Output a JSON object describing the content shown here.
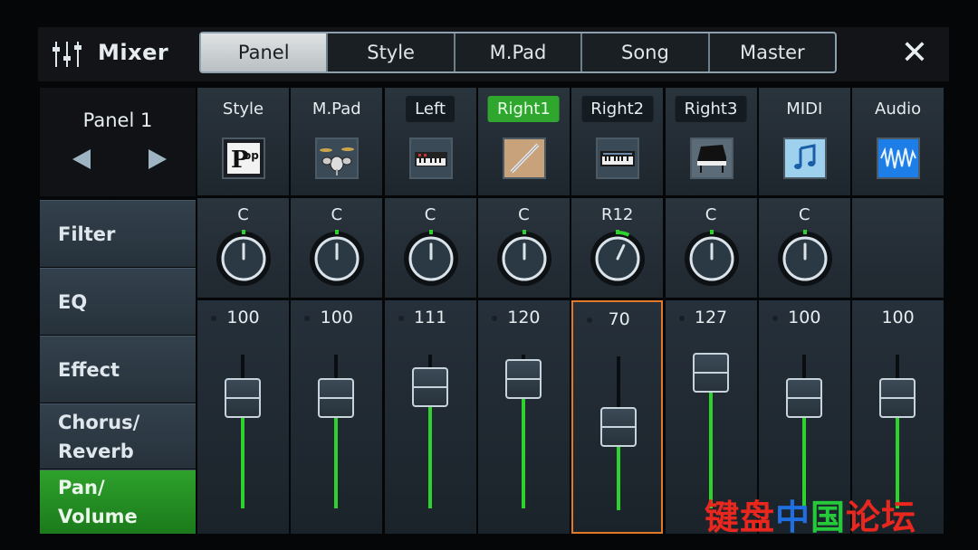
{
  "window": {
    "title": "Mixer",
    "close_label": "✕"
  },
  "tabs": [
    {
      "label": "Panel",
      "active": true
    },
    {
      "label": "Style",
      "active": false
    },
    {
      "label": "M.Pad",
      "active": false
    },
    {
      "label": "Song",
      "active": false
    },
    {
      "label": "Master",
      "active": false
    }
  ],
  "panel_selector": {
    "name": "Panel 1"
  },
  "side_menu": [
    {
      "label": "Filter",
      "active": false
    },
    {
      "label": "EQ",
      "active": false
    },
    {
      "label": "Effect",
      "active": false
    },
    {
      "label": "Chorus/\nReverb",
      "active": false
    },
    {
      "label": "Pan/\nVolume",
      "active": true
    }
  ],
  "channels": [
    {
      "label": "Style",
      "label_style": "plain",
      "icon": "pop-style-icon",
      "pan": "C",
      "pan_value": 0,
      "volume": "100",
      "volume_value": 100,
      "has_pan": true
    },
    {
      "label": "M.Pad",
      "label_style": "plain",
      "icon": "drum-kit-icon",
      "pan": "C",
      "pan_value": 0,
      "volume": "100",
      "volume_value": 100,
      "has_pan": true
    },
    {
      "label": "Left",
      "label_style": "boxed",
      "icon": "synth-keyboard-icon",
      "pan": "C",
      "pan_value": 0,
      "volume": "111",
      "volume_value": 111,
      "has_pan": true
    },
    {
      "label": "Right1",
      "label_style": "active",
      "icon": "flute-icon",
      "pan": "C",
      "pan_value": 0,
      "volume": "120",
      "volume_value": 120,
      "has_pan": true
    },
    {
      "label": "Right2",
      "label_style": "boxed",
      "icon": "keyboard-icon",
      "pan": "R12",
      "pan_value": 12,
      "volume": "70",
      "volume_value": 70,
      "has_pan": true,
      "selected": true
    },
    {
      "label": "Right3",
      "label_style": "boxed",
      "icon": "grand-piano-icon",
      "pan": "C",
      "pan_value": 0,
      "volume": "127",
      "volume_value": 127,
      "has_pan": true
    },
    {
      "label": "MIDI",
      "label_style": "plain",
      "icon": "music-note-icon",
      "pan": "C",
      "pan_value": 0,
      "volume": "100",
      "volume_value": 100,
      "has_pan": true
    },
    {
      "label": "Audio",
      "label_style": "plain",
      "icon": "waveform-icon",
      "pan": "",
      "pan_value": 0,
      "volume": "100",
      "volume_value": 100,
      "has_pan": false
    }
  ],
  "watermark": {
    "chars": [
      "键",
      "盘",
      "中",
      "国",
      "论",
      "坛"
    ],
    "colors": [
      "#e8271f",
      "#e8271f",
      "#1f6fe0",
      "#25c93a",
      "#e8271f",
      "#e8271f"
    ]
  },
  "colors": {
    "accent_green": "#2fa72f",
    "fader_green": "#2fd12f",
    "selection_orange": "#e07a2a"
  }
}
